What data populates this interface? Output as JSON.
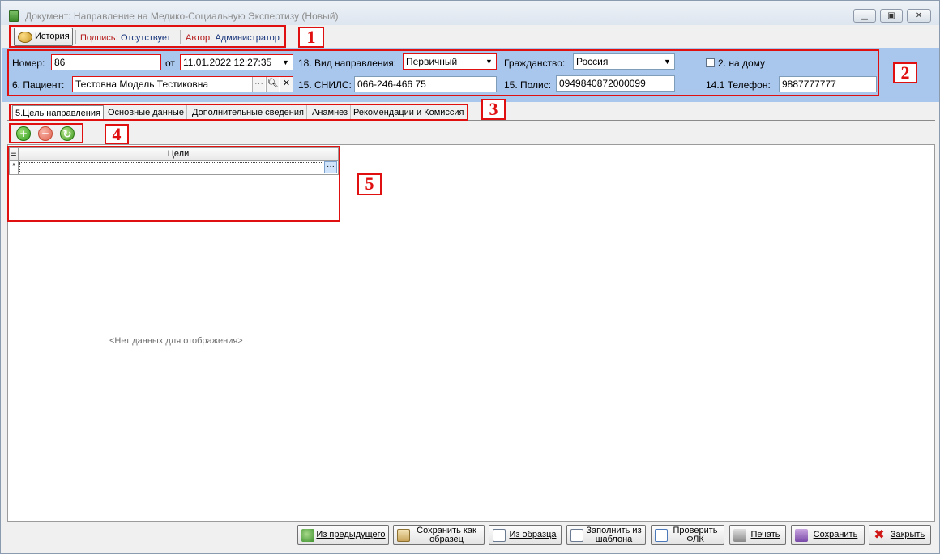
{
  "window": {
    "title": "Документ: Направление на Медико-Социальную Экспертизу (Новый)",
    "min_icon": "minimize-icon",
    "max_icon": "maximize-icon",
    "close_icon": "close-icon"
  },
  "annotations": [
    "1",
    "2",
    "3",
    "4",
    "5"
  ],
  "topbar": {
    "history_label": "История",
    "signature_label": "Подпись:",
    "signature_value": "Отсутствует",
    "author_label": "Автор:",
    "author_value": "Администратор"
  },
  "header": {
    "number_label": "Номер:",
    "number_value": "86",
    "from_label": "от",
    "date_value": "11.01.2022 12:27:35",
    "patient_label": "6. Пациент:",
    "patient_value": "Тестовна Модель Тестиковна",
    "direction_type_label": "18. Вид направления:",
    "direction_type_value": "Первичный",
    "snils_label": "15. СНИЛС:",
    "snils_value": "066-246-466 75",
    "citizenship_label": "Гражданство:",
    "citizenship_value": "Россия",
    "policy_label": "15. Полис:",
    "policy_value": "0949840872000099",
    "at_home_label": "2. на дому",
    "at_home_checked": false,
    "phone_label": "14.1 Телефон:",
    "phone_value": "9887777777"
  },
  "tabs": [
    {
      "label": "5.Цель направления",
      "active": true
    },
    {
      "label": "Основные данные",
      "active": false
    },
    {
      "label": "Дополнительные сведения",
      "active": false
    },
    {
      "label": "Анамнез",
      "active": false
    },
    {
      "label": "Рекомендации и Комиссия",
      "active": false
    }
  ],
  "toolbar": {
    "add_icon": "add-icon",
    "delete_icon": "delete-icon",
    "refresh_icon": "refresh-icon"
  },
  "grid": {
    "column_header": "Цели",
    "new_row_marker": "*",
    "ellipsis": "···",
    "empty_text": "<Нет данных для отображения>"
  },
  "bottom_buttons": {
    "from_previous": "Из предыдущего",
    "save_as_template": "Сохранить как образец",
    "from_template": "Из образца",
    "fill_from_template": "Заполнить из шаблона",
    "check_flk": "Проверить ФЛК",
    "print": "Печать",
    "save": "Сохранить",
    "close": "Закрыть"
  },
  "colors": {
    "header_panel": "#a9c6ec",
    "annotation_red": "#e01010",
    "label_red": "#b41818",
    "value_blue": "#14327a"
  }
}
